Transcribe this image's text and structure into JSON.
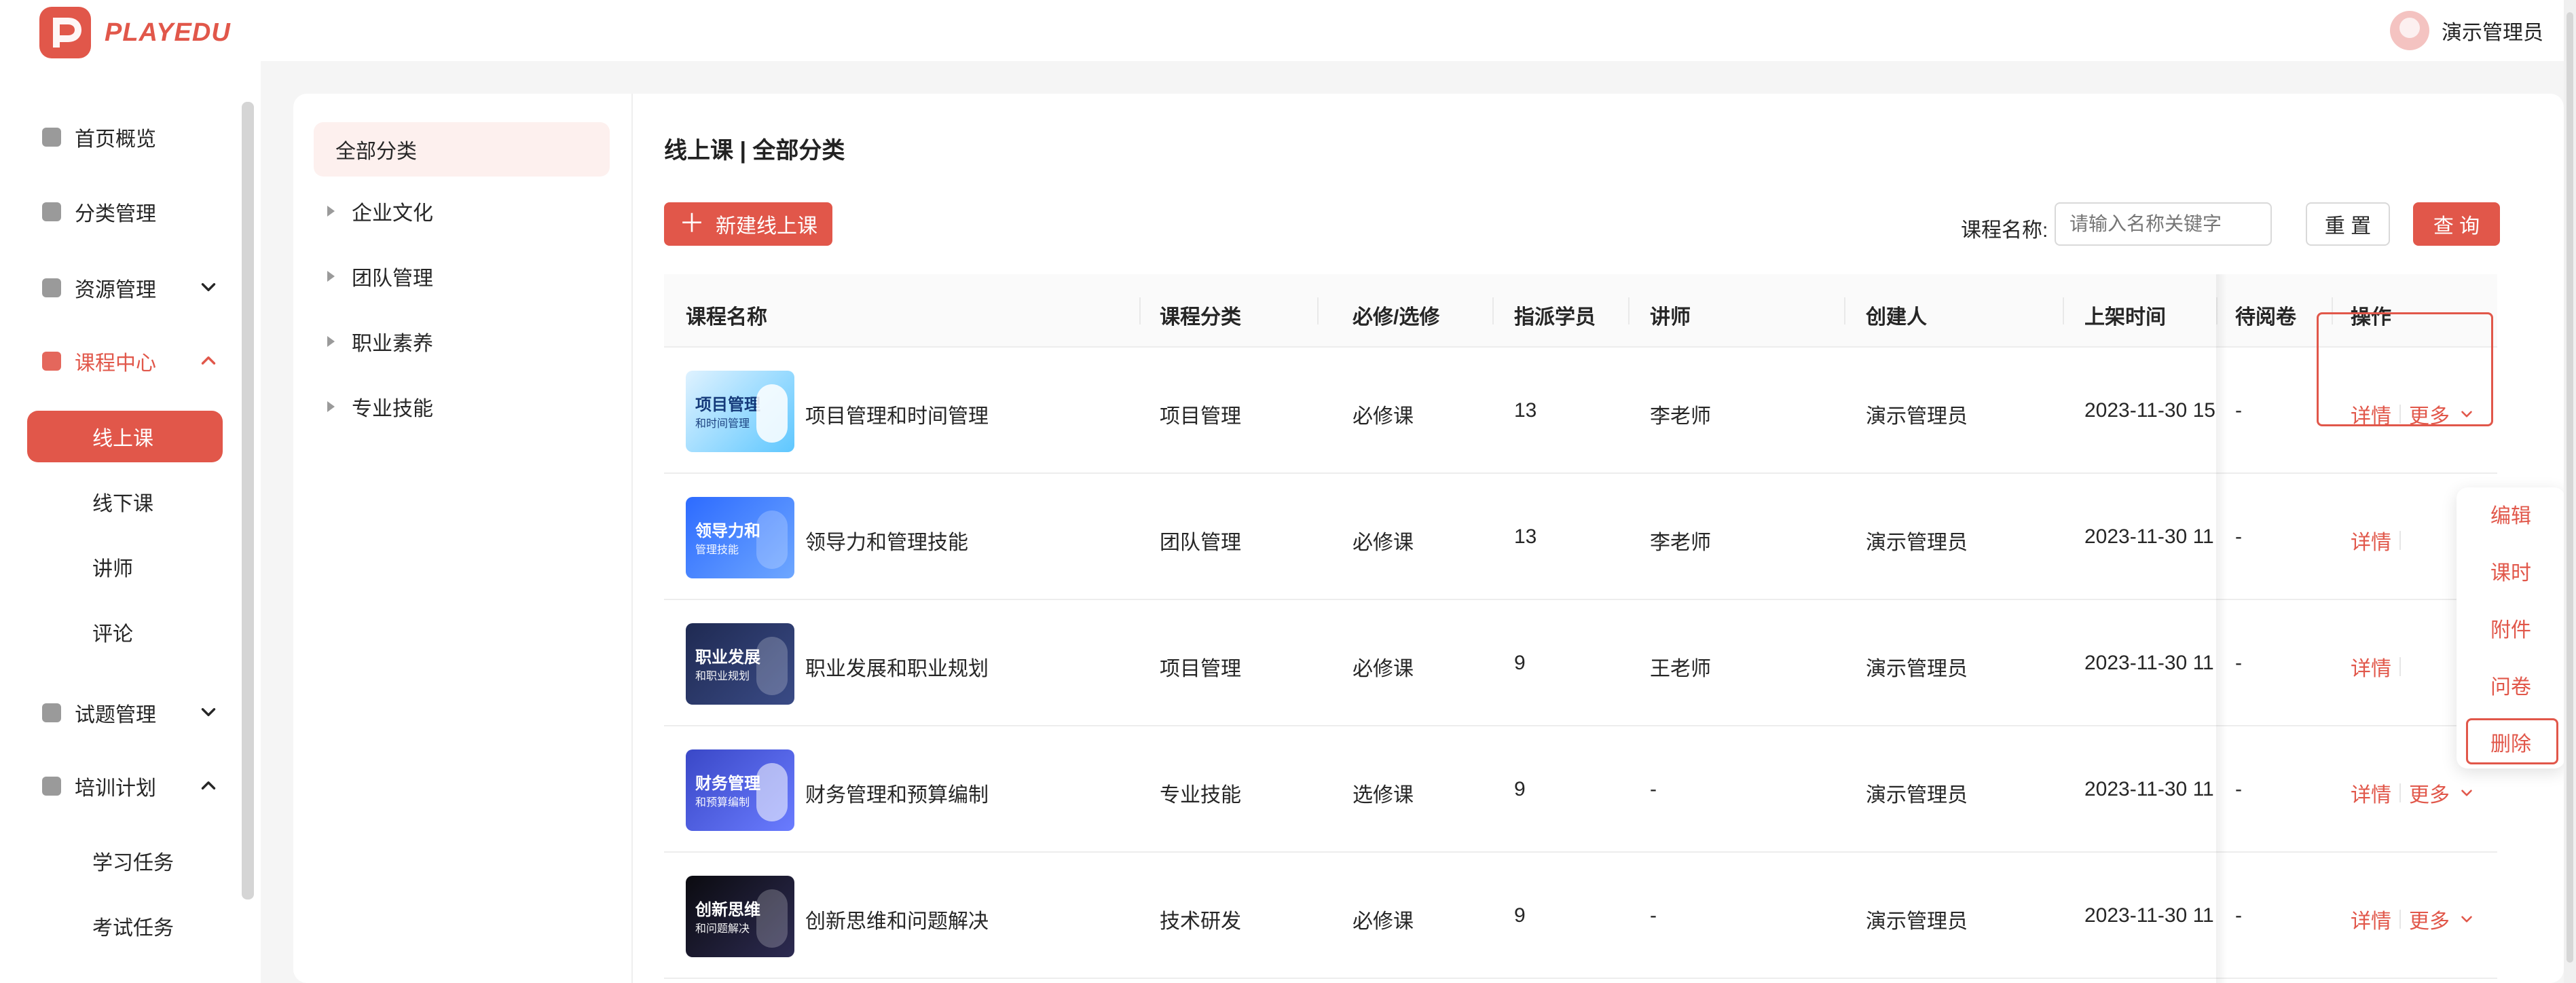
{
  "app": {
    "brand": "PLAYEDU",
    "user_name": "演示管理员",
    "accent_color": "#e1574a"
  },
  "sidebar": {
    "items": [
      {
        "label": "首页概览",
        "icon": "home-icon"
      },
      {
        "label": "分类管理",
        "icon": "category-icon"
      },
      {
        "label": "资源管理",
        "icon": "folder-icon",
        "expandable": true
      },
      {
        "label": "课程中心",
        "icon": "book-icon",
        "expandable": true,
        "expanded": true
      },
      {
        "label": "试题管理",
        "icon": "exam-icon",
        "expandable": true
      },
      {
        "label": "培训计划",
        "icon": "training-icon",
        "expandable": true,
        "expanded": true
      }
    ],
    "course_center_children": [
      "线上课",
      "线下课",
      "讲师",
      "评论"
    ],
    "training_children": [
      "学习任务",
      "考试任务"
    ]
  },
  "categories": {
    "active": "全部分类",
    "items": [
      "企业文化",
      "团队管理",
      "职业素养",
      "专业技能"
    ]
  },
  "main": {
    "title": "线上课 | 全部分类",
    "new_button": "新建线上课",
    "search": {
      "label": "课程名称:",
      "placeholder": "请输入名称关键字",
      "reset": "重 置",
      "query": "查 询"
    }
  },
  "table": {
    "headers": [
      "课程名称",
      "课程分类",
      "必修/选修",
      "指派学员",
      "讲师",
      "创建人",
      "上架时间",
      "待阅卷",
      "操作"
    ],
    "rows": [
      {
        "thumb_title": "项目管理",
        "thumb_sub": "和时间管理",
        "name": "项目管理和时间管理",
        "category": "项目管理",
        "type": "必修课",
        "assigned": "13",
        "teacher": "李老师",
        "creator": "演示管理员",
        "published": "2023-11-30 15",
        "pending": "-",
        "op_detail": "详情",
        "op_more": "更多"
      },
      {
        "thumb_title": "领导力和",
        "thumb_sub": "管理技能",
        "name": "领导力和管理技能",
        "category": "团队管理",
        "type": "必修课",
        "assigned": "13",
        "teacher": "李老师",
        "creator": "演示管理员",
        "published": "2023-11-30 11",
        "pending": "-",
        "op_detail": "详情",
        "op_more": ""
      },
      {
        "thumb_title": "职业发展",
        "thumb_sub": "和职业规划",
        "name": "职业发展和职业规划",
        "category": "项目管理",
        "type": "必修课",
        "assigned": "9",
        "teacher": "王老师",
        "creator": "演示管理员",
        "published": "2023-11-30 11",
        "pending": "-",
        "op_detail": "详情",
        "op_more": ""
      },
      {
        "thumb_title": "财务管理",
        "thumb_sub": "和预算编制",
        "name": "财务管理和预算编制",
        "category": "专业技能",
        "type": "选修课",
        "assigned": "9",
        "teacher": "-",
        "creator": "演示管理员",
        "published": "2023-11-30 11",
        "pending": "-",
        "op_detail": "详情",
        "op_more": "更多"
      },
      {
        "thumb_title": "创新思维",
        "thumb_sub": "和问题解决",
        "name": "创新思维和问题解决",
        "category": "技术研发",
        "type": "必修课",
        "assigned": "9",
        "teacher": "-",
        "creator": "演示管理员",
        "published": "2023-11-30 11",
        "pending": "-",
        "op_detail": "详情",
        "op_more": "更多"
      }
    ]
  },
  "more_menu": {
    "items": [
      "编辑",
      "课时",
      "附件",
      "问卷",
      "删除"
    ]
  }
}
